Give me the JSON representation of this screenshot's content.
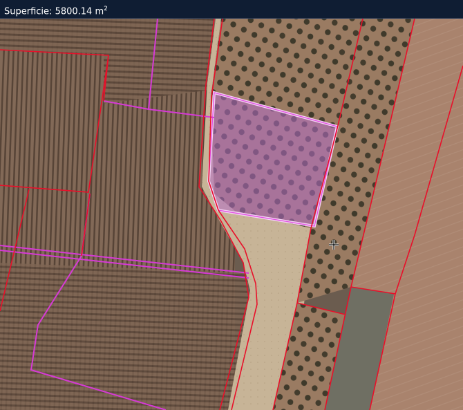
{
  "header": {
    "area_label": "Superficie:",
    "area_value": "5800.14 m",
    "area_unit_exp": "2"
  },
  "colors": {
    "title_bar_bg": "#0f1d33",
    "parcel_border": "#e8102a",
    "cadastral_boundary": "#d63ad6",
    "selected_fill": "#b46ec8",
    "selected_outline": "#f4d2f4",
    "vineyard": "#7c6250",
    "olive_grove": "#8a7058",
    "dirt_track": "#c9b597",
    "field": "#a7806a"
  },
  "map": {
    "layer": "aerial-orthophoto",
    "selected_parcel": true,
    "cursor": "move-cursor-icon"
  }
}
